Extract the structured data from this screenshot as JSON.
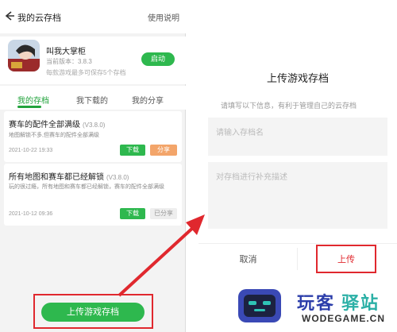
{
  "left": {
    "header": {
      "title": "我的云存档",
      "help": "使用说明"
    },
    "game": {
      "name": "叫我大掌柜",
      "version": "当前版本：3.8.3",
      "tip": "每款游戏最多可保存5个存档",
      "launch_label": "启动"
    },
    "tabs": [
      {
        "label": "我的存档",
        "active": true
      },
      {
        "label": "我下载的",
        "active": false
      },
      {
        "label": "我的分享",
        "active": false
      }
    ],
    "saves": [
      {
        "title": "赛车的配件全部满级",
        "version": "(V3.8.0)",
        "desc": "地图解锁不多,但赛车的配件全部满级",
        "date": "2021-10-22 19:33",
        "download_label": "下载",
        "share_label": "分享"
      },
      {
        "title": "所有地图和赛车都已经解锁",
        "version": "(V3.8.0)",
        "desc": "玩的很过瘾，所有地图和赛车都已经解锁，赛车的配件全部满级",
        "date": "2021-10-12 09:36",
        "download_label": "下载",
        "share_label": "已分享"
      }
    ],
    "upload_label": "上传游戏存档"
  },
  "dialog": {
    "title": "上传游戏存档",
    "hint": "请填写以下信息，有利于管理自己的云存档",
    "name_placeholder": "请输入存档名",
    "desc_placeholder": "对存档进行补充描述",
    "cancel_label": "取消",
    "upload_label": "上传"
  },
  "watermark": {
    "cn_part1": "玩客",
    "cn_part2": "驿站",
    "en": "WODEGAME.CN"
  },
  "colors": {
    "accent": "#2eb84e",
    "highlight": "#e0282e",
    "share": "#f3a56a"
  }
}
